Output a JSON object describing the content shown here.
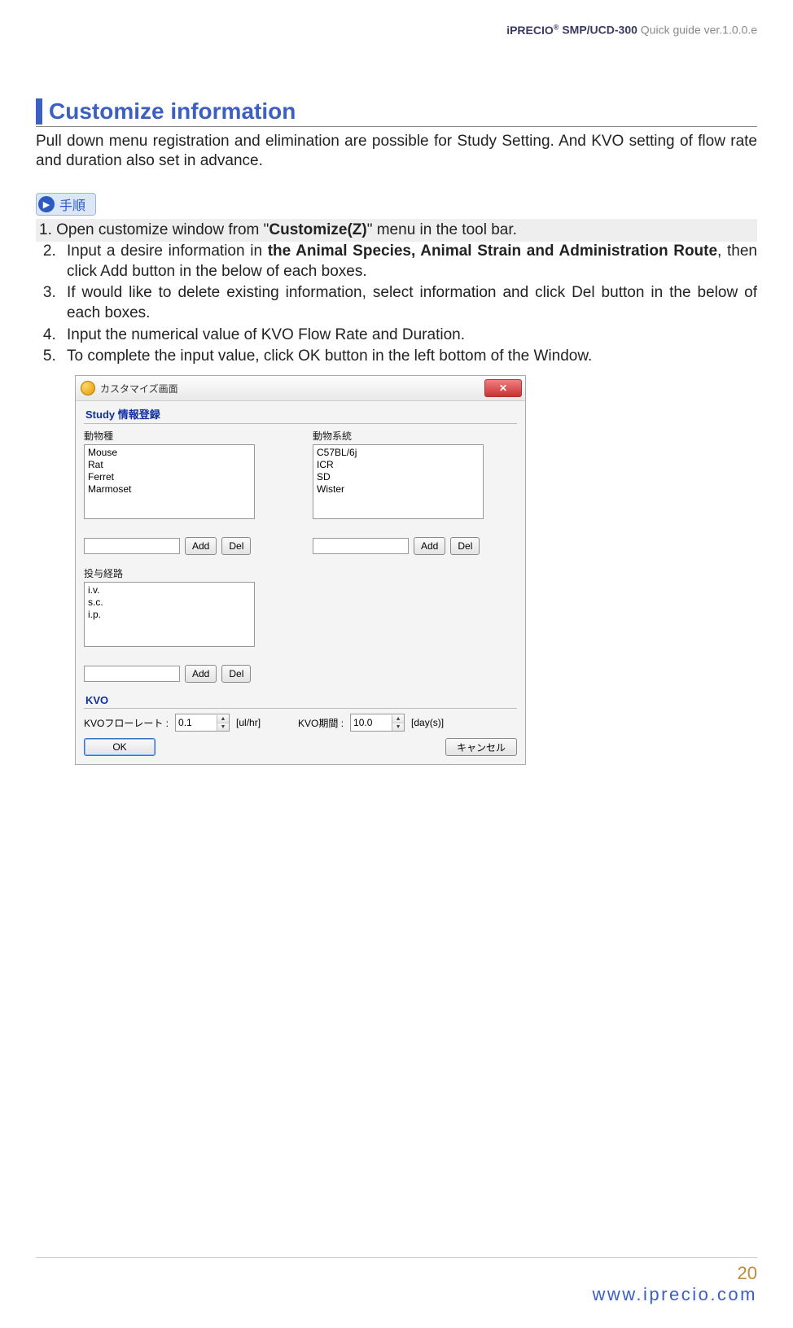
{
  "header": {
    "brand_prefix": "iPRECIO",
    "brand_r": "®",
    "model_bold": "SMP",
    "slash": "/",
    "model_tail": "UCD-300",
    "tail_gray": " Quick guide ver.1.0.0.e"
  },
  "section": {
    "title": "Customize information",
    "intro": "Pull down menu registration and elimination are possible for Study Setting. And KVO setting of flow rate and duration also set in advance."
  },
  "step_badge": "手順",
  "steps": {
    "s1_pre": "1.  Open customize window ",
    "s1_from": "from \"",
    "s1_bold": "Customize(Z)",
    "s1_post": "\" menu in the tool bar.",
    "s2_pre": "Input a desire information in ",
    "s2_bold": "the Animal Species, Animal Strain and Administration Route",
    "s2_post": ", then click Add button in the below of each boxes.",
    "s3": "If would like to delete existing information, select information and click Del button in the below of each boxes.",
    "s4": "Input the numerical value of KVO Flow Rate and Duration.",
    "s5": "To complete the input value, click OK button in the left bottom of the Window."
  },
  "dialog": {
    "title": "カスタマイズ画面",
    "group_study": "Study 情報登録",
    "label_species": "動物種",
    "label_strain": "動物系統",
    "label_route": "投与経路",
    "species_items": [
      "Mouse",
      "Rat",
      "Ferret",
      "Marmoset"
    ],
    "strain_items": [
      "C57BL/6j",
      "ICR",
      "SD",
      "Wister"
    ],
    "route_items": [
      "i.v.",
      "s.c.",
      "i.p."
    ],
    "btn_add": "Add",
    "btn_del": "Del",
    "kvo_title": "KVO",
    "kvo_flow_label": "KVOフローレート :",
    "kvo_flow_value": "0.1",
    "kvo_flow_unit": "[ul/hr]",
    "kvo_dur_label": "KVO期間 :",
    "kvo_dur_value": "10.0",
    "kvo_dur_unit": "[day(s)]",
    "btn_ok": "OK",
    "btn_cancel": "キャンセル"
  },
  "footer": {
    "page": "20",
    "url": "www.iprecio.com"
  }
}
